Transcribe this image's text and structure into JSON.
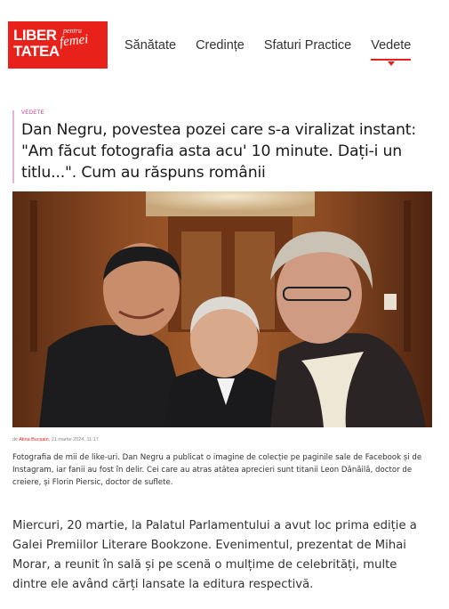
{
  "logo": {
    "main_line1": "LIBER",
    "main_line2": "TATEA",
    "sub_small": "pentru",
    "sub": "femei",
    "brand_color": "#e8221b"
  },
  "nav": {
    "items": [
      {
        "label": "Sănătate"
      },
      {
        "label": "Credințe"
      },
      {
        "label": "Sfaturi Practice"
      },
      {
        "label": "Vedete",
        "active": true
      }
    ]
  },
  "article": {
    "category": "Vedete",
    "title": "Dan Negru, povestea pozei care s-a viralizat instant: \"Am făcut fotografia asta acu' 10 minute. Dați-i un titlu...\". Cum au răspuns românii",
    "photo_alt": "Dan Negru, Leon Dănăilă și Florin Piersic",
    "meta_prefix": "de ",
    "author": "Alina Bucșain",
    "date": ", 21 martie 2024, 11:17",
    "caption": "Fotografia de mii de like-uri. Dan Negru a publicat o imagine de colecție pe paginile sale de Facebook și de Instagram, iar fanii au fost în delir. Cei care au atras atâtea aprecieri sunt titanii Leon Dănăilă, doctor de creiere, și Florin Piersic, doctor de suflete.",
    "body": "Miercuri, 20 martie, la Palatul Parlamentului a avut loc prima ediție a Galei Premiilor Literare Bookzone. Evenimentul, prezentat de Mihai Morar, a reunit în sală și pe scenă o mulțime de celebrități, multe dintre ele având cărți lansate la editura respectivă."
  }
}
